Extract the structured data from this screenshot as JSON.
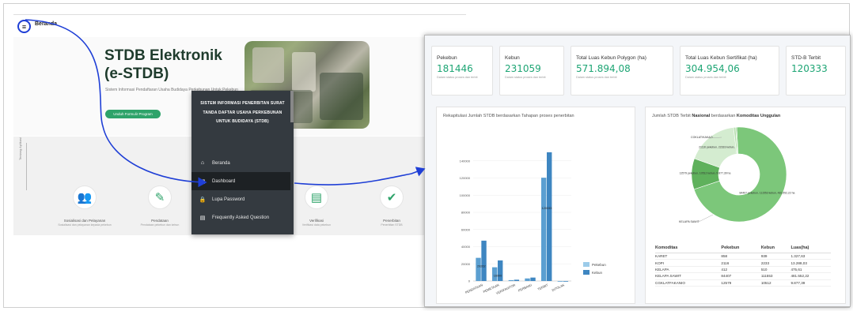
{
  "landing": {
    "menu_icon": "≡",
    "nav_label": "Beranda",
    "hero_title": "STDB Elektronik (e-STDB)",
    "hero_subtitle": "Sistem Informasi Pendaftaran Usaha Budidaya Perkebunan Untuk Pekebun",
    "hero_button": "Unduh Formulir Program",
    "side_label": "Tentang Aplikasi",
    "features": [
      {
        "icon": "users-icon",
        "glyph": "👥",
        "label": "Sosialisasi dan Pelayanan",
        "sub": "Sosialisasi dan pelayanan kepada pekebun"
      },
      {
        "icon": "form-icon",
        "glyph": "✎",
        "label": "Pendataan",
        "sub": "Pendataan pekebun dan kebun"
      },
      {
        "icon": "clipboard-icon",
        "glyph": "▤",
        "label": "Verifikasi",
        "sub": "Verifikasi data pekebun"
      },
      {
        "icon": "check-icon",
        "glyph": "✔",
        "label": "Penerbitan",
        "sub": "Penerbitan STDB"
      }
    ]
  },
  "sidebar": {
    "heading": "SISTEM INFORMASI PENERBITAN SURAT TANDA DAFTAR USAHA PERKEBUNAN UNTUK BUDIDAYA (STDB)",
    "items": [
      {
        "label": "Beranda",
        "icon": "home-icon",
        "glyph": "⌂"
      },
      {
        "label": "Dashboard",
        "icon": "dashboard-icon",
        "glyph": "▦"
      },
      {
        "label": "Lupa Password",
        "icon": "lock-icon",
        "glyph": "🔒"
      },
      {
        "label": "Frequently Asked Question",
        "icon": "faq-icon",
        "glyph": "▤"
      }
    ]
  },
  "dashboard": {
    "stats": [
      {
        "title": "Pekebun",
        "value": "181446",
        "desc": "Dalam status proses dan terbit"
      },
      {
        "title": "Kebun",
        "value": "231059",
        "desc": "Dalam status proses dan terbit"
      },
      {
        "title": "Total Luas Kebun Polygon (ha)",
        "value": "571.894,08",
        "desc": "Dalam status proses dan terbit"
      },
      {
        "title": "Total Luas Kebun Sertifikat (ha)",
        "value": "304.954,06",
        "desc": "Dalam status proses dan terbit"
      },
      {
        "title": "STD-B Terbit",
        "value": "120333",
        "desc": ""
      }
    ],
    "bar_card_title": "Rekapitulasi Jumlah STDB berdasarkan Tahapan proses penerbitan",
    "donut_card_title_pre": "Jumlah STDB Terbit ",
    "donut_card_title_b1": "Nasional",
    "donut_card_title_mid": " berdasarkan ",
    "donut_card_title_b2": "Komoditas Unggulan",
    "table_headers": [
      "Komoditas",
      "Pekebun",
      "Kebun",
      "Luas(ha)"
    ],
    "table_rows": [
      [
        "KARET",
        "858",
        "939",
        "1.327,63"
      ],
      [
        "KOPI",
        "2116",
        "2233",
        "13.288,03"
      ],
      [
        "KELAPA",
        "412",
        "510",
        "475,61"
      ],
      [
        "KELAPA SAWIT",
        "84407",
        "111553",
        "481.552,22"
      ],
      [
        "CGKLATFAKANIO",
        "12579",
        "10512",
        "9.877,39"
      ]
    ]
  },
  "colors": {
    "accent": "#2ea36a",
    "stat_value": "#1da574",
    "sidebar_bg": "#343a40",
    "bar_light": "#8fc6e6",
    "bar_dark": "#3b86c2",
    "donut_dark": "#6cc36e",
    "donut_light": "#a9dca3",
    "donut_pale": "#e3f2df",
    "arrow": "#1f3fd6"
  },
  "chart_data": [
    {
      "type": "bar",
      "title": "Rekapitulasi Jumlah STDB berdasarkan Tahapan proses penerbitan",
      "categories": [
        "PENDATAAN",
        "PEMETAAN",
        "VERIFIKATOR",
        "DIPERBAIKI",
        "TERBIT",
        "DITOLAK"
      ],
      "category_labels": [
        "PENDATAAN",
        "PEMETAAN",
        "VERIFIKATOR",
        "PERBAIKI",
        "TERBIT",
        "DITOLAK"
      ],
      "ylim": [
        0,
        160000
      ],
      "yticks": [
        "0",
        "20000",
        "40000",
        "60000",
        "80000",
        "100000",
        "120000",
        "140000"
      ],
      "series": [
        {
          "name": "Pekebun",
          "values": [
            27000,
            16000,
            1000,
            3000,
            120333,
            0
          ]
        },
        {
          "name": "Kebun",
          "values": [
            47000,
            24000,
            1500,
            4000,
            150000,
            0
          ]
        }
      ],
      "data_labels": [
        "29262",
        "16000",
        "",
        "",
        "120333",
        ""
      ],
      "legend": "bottom-right"
    },
    {
      "type": "pie",
      "title": "Jumlah STDB Terbit Nasional berdasarkan Komoditas Unggulan",
      "slices": [
        {
          "name": "KELAPA SAWIT",
          "value": 84407,
          "label": "84407 pekebun, 111553 kebun, 481.552,22 ha"
        },
        {
          "name": "COKLAT/KAKAO",
          "value": 12579,
          "label": "12579 pekebun, 10512 kebun, 9.877,39 ha"
        },
        {
          "name": "KOPI",
          "value": 21116,
          "label": "21116 pekebun, 22333 kebun, 1"
        },
        {
          "name": "KARET",
          "value": 858,
          "label": ""
        },
        {
          "name": "KELAPA",
          "value": 412,
          "label": ""
        }
      ],
      "outer_labels": [
        "COKLAT/KAKAO",
        "KELAPA SAWIT"
      ]
    }
  ]
}
